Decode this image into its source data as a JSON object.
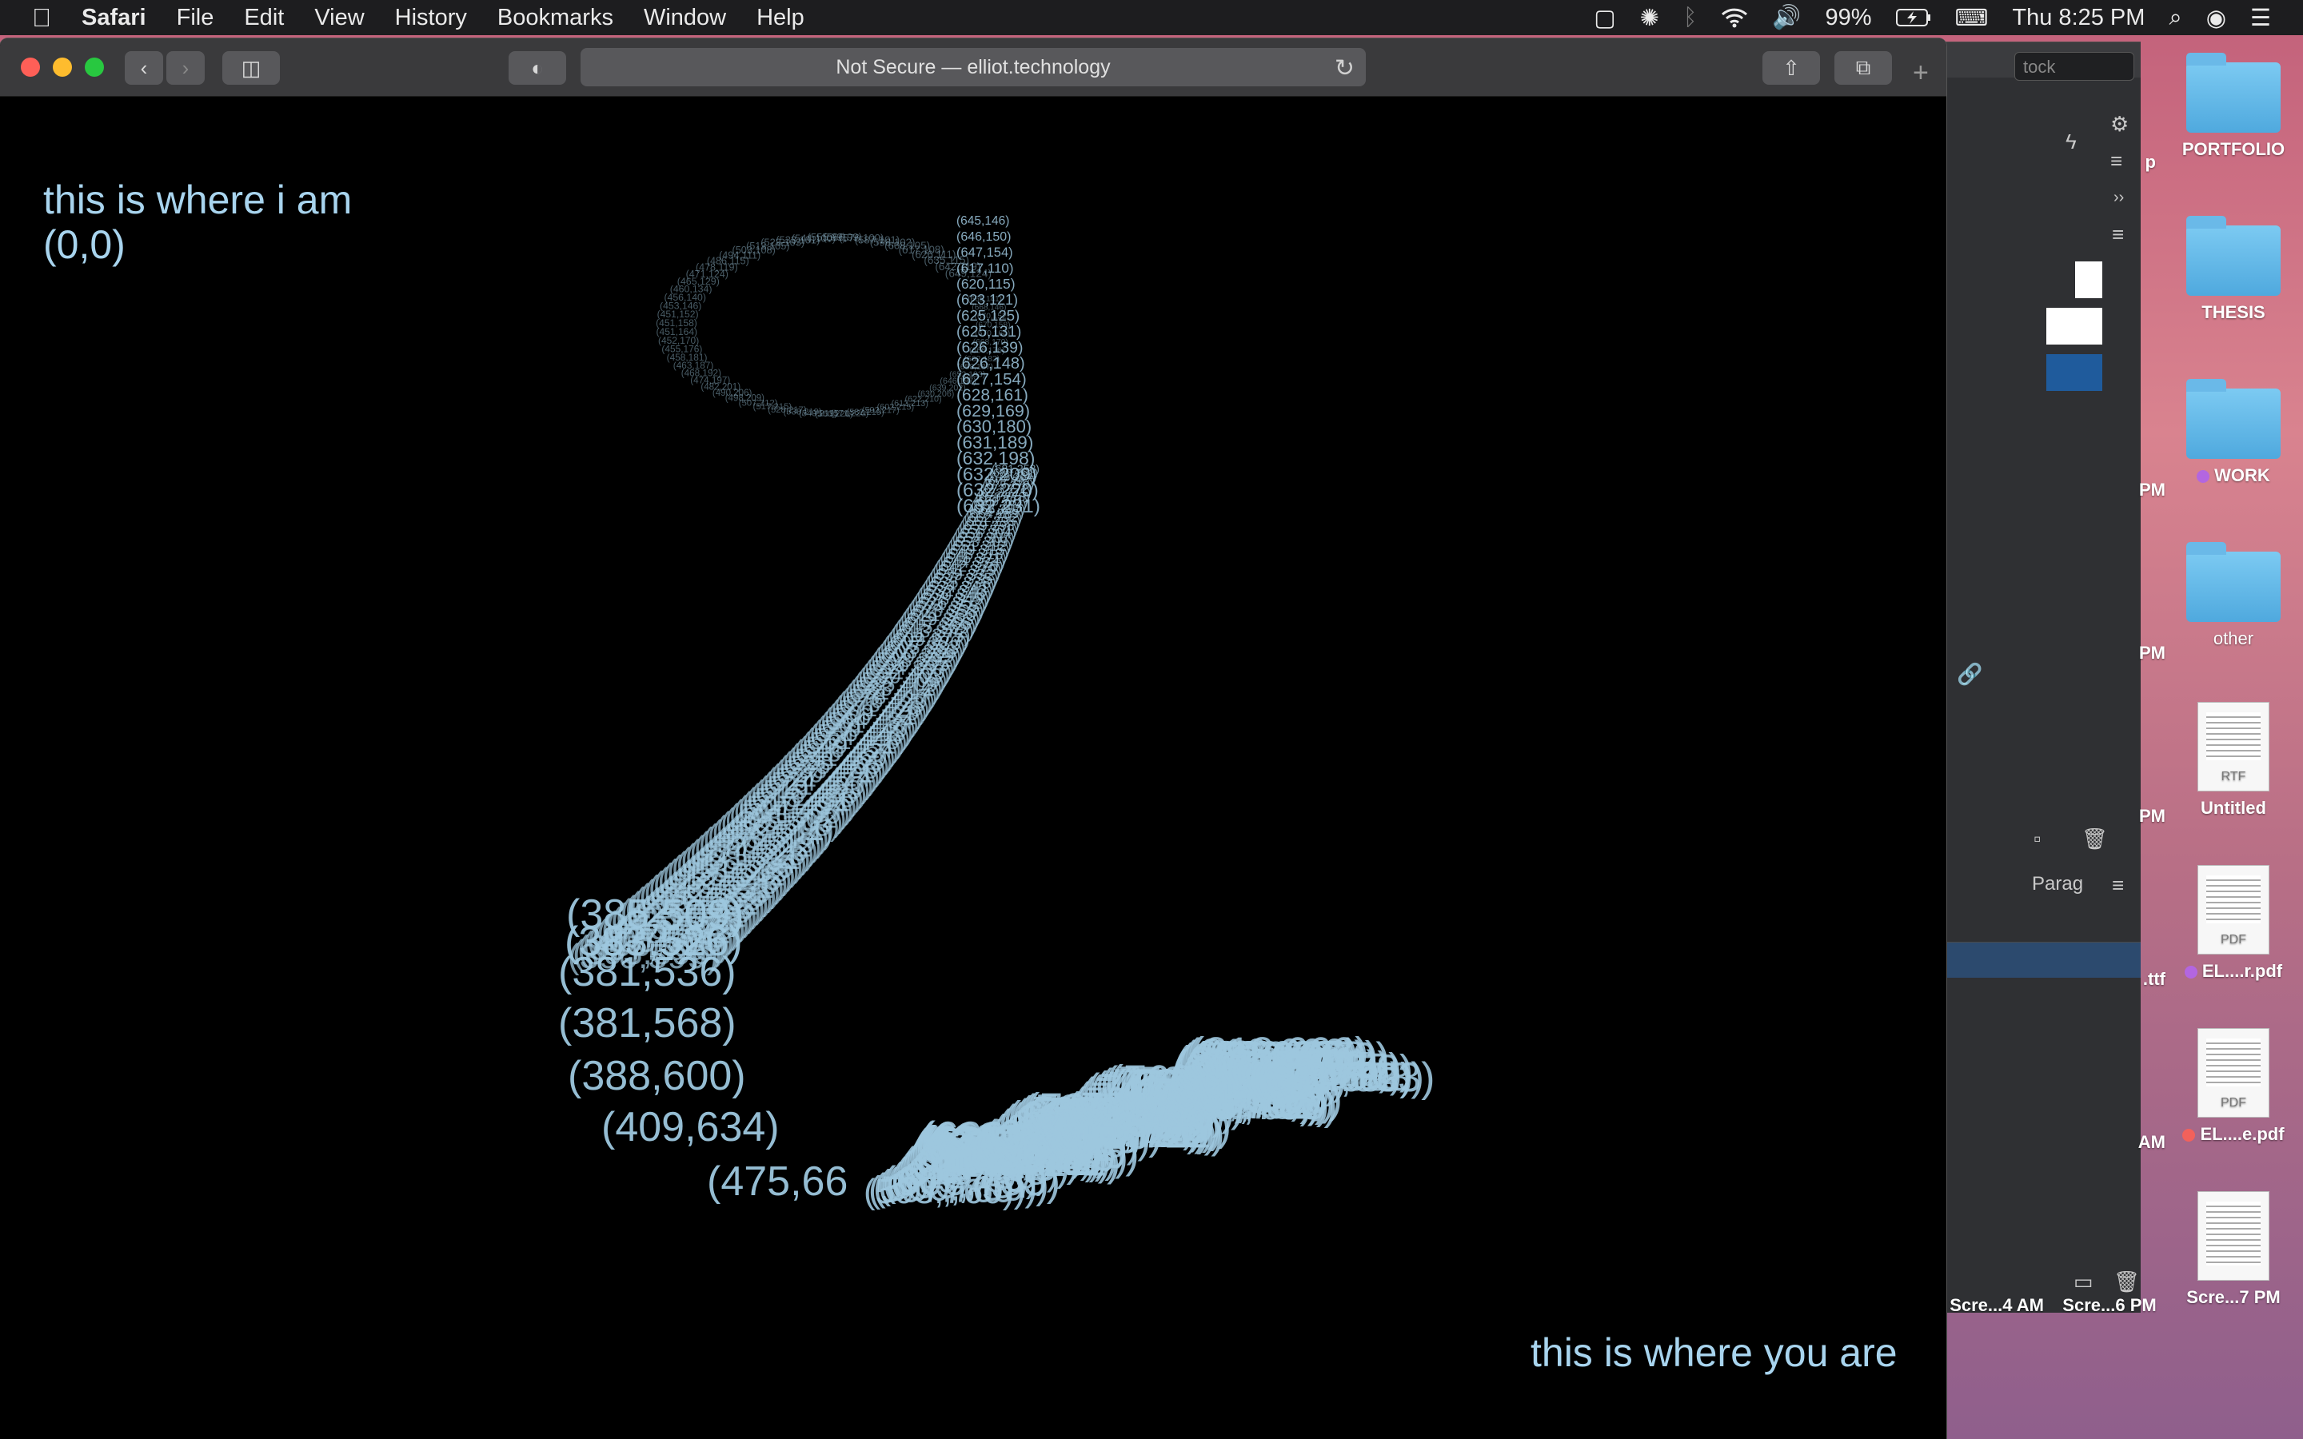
{
  "menubar": {
    "apple": "",
    "app": "Safari",
    "items": [
      "File",
      "Edit",
      "View",
      "History",
      "Bookmarks",
      "Window",
      "Help"
    ],
    "battery": "99%",
    "clock": "Thu 8:25 PM"
  },
  "safari": {
    "address": "Not Secure — elliot.technology",
    "new_tab": "+"
  },
  "page": {
    "top_left_line1": "this is where i am",
    "top_left_line2": "(0,0)",
    "bottom_right": "this is where you are"
  },
  "trail": {
    "color": "#9dc7de",
    "large_labels": [
      "(385,509)",
      "(383,526)",
      "(381,536)",
      "(381,568)",
      "(388,600)",
      "(409,634)",
      "(475,66"
    ],
    "small_labels": [
      "(632,231)",
      "(632,220)",
      "(632,209)",
      "(632,198)",
      "(631,189)",
      "(630,180)",
      "(629,169)",
      "(628,161)",
      "(627,154)",
      "(626,148)",
      "(626,139)",
      "(625,131)",
      "(625,125)",
      "(623,121)",
      "(620,115)",
      "(617,110)",
      "(647,154)",
      "(646,150)",
      "(645,146)"
    ]
  },
  "backdrop_app": {
    "search": "tock",
    "panel_label": "Parag"
  },
  "desktop": {
    "icons": [
      {
        "label": "PORTFOLIO",
        "kind": "folder"
      },
      {
        "label": "THESIS",
        "kind": "folder"
      },
      {
        "label": "WORK",
        "kind": "folder",
        "tag_color": "#b366e0"
      },
      {
        "label": "other",
        "kind": "folder"
      },
      {
        "label": "Untitled",
        "kind": "doc",
        "badge": "RTF"
      },
      {
        "label": "EL....r.pdf",
        "kind": "doc",
        "badge": "PDF",
        "tag_color": "#b366e0"
      },
      {
        "label": "EL....e.pdf",
        "kind": "doc",
        "badge": "PDF",
        "tag_color": "#f2615b"
      },
      {
        "label": "Scre...7 PM",
        "kind": "doc",
        "badge": ""
      }
    ],
    "partial_labels": [
      "p",
      "PM",
      "PM",
      "PM",
      ".ttf",
      "AM",
      "Scre...4 AM",
      "Scre...6 PM"
    ]
  }
}
